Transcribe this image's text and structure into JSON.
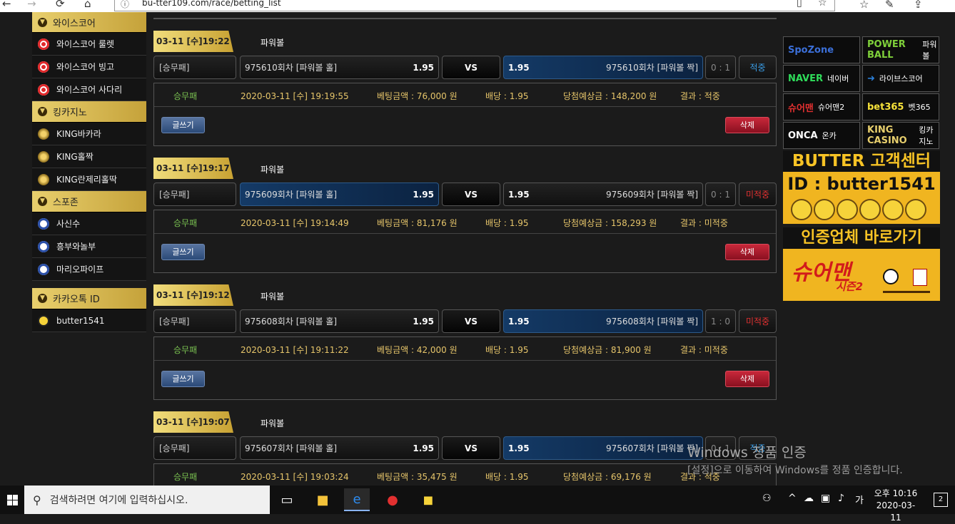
{
  "browser": {
    "url": "bu-tter109.com/race/betting_list",
    "back": "←",
    "forward": "→",
    "refresh": "⟳",
    "home": "⌂",
    "reading": "▯",
    "fav": "☆",
    "favs": "☆",
    "pen": "✎",
    "share": "⇪"
  },
  "sidebar": {
    "sections": [
      {
        "title": "와이스코어",
        "items": [
          "와이스코어 룰렛",
          "와이스코어 빙고",
          "와이스코어 사다리"
        ]
      },
      {
        "title": "킹카지노",
        "items": [
          "KING바카라",
          "KING홀짝",
          "KING란제리홀딱"
        ]
      },
      {
        "title": "스포존",
        "items": [
          "사신수",
          "흥부와놀부",
          "마리오파이프"
        ]
      },
      {
        "title": "카카오톡 ID",
        "items": [
          "butter1541"
        ]
      }
    ]
  },
  "labels": {
    "vs": "VS",
    "write": "글쓰기",
    "delete": "삭제"
  },
  "bets": [
    {
      "date": "03-11 [수]19:22",
      "game": "파워볼",
      "type": "[승무패]",
      "home": "975610회차 [파워볼 홀]",
      "home_odds": "1.95",
      "away": "975610회차 [파워볼 짝]",
      "away_odds": "1.95",
      "selected": "away",
      "score": "0 : 1",
      "result": "적중",
      "result_color": "#3a9ee8",
      "d_type": "승무패",
      "d_time": "2020-03-11 [수] 19:19:55",
      "d_amount": "베팅금액 : 76,000 원",
      "d_odds": "배당 : 1.95",
      "d_expect": "당첨예상금 : 148,200 원",
      "d_result": "결과 : 적중"
    },
    {
      "date": "03-11 [수]19:17",
      "game": "파워볼",
      "type": "[승무패]",
      "home": "975609회차 [파워볼 홀]",
      "home_odds": "1.95",
      "away": "975609회차 [파워볼 짝]",
      "away_odds": "1.95",
      "selected": "home",
      "score": "0 : 1",
      "result": "미적중",
      "result_color": "#e23030",
      "d_type": "승무패",
      "d_time": "2020-03-11 [수] 19:14:49",
      "d_amount": "베팅금액 : 81,176 원",
      "d_odds": "배당 : 1.95",
      "d_expect": "당첨예상금 : 158,293 원",
      "d_result": "결과 : 미적중"
    },
    {
      "date": "03-11 [수]19:12",
      "game": "파워볼",
      "type": "[승무패]",
      "home": "975608회차 [파워볼 홀]",
      "home_odds": "1.95",
      "away": "975608회차 [파워볼 짝]",
      "away_odds": "1.95",
      "selected": "away",
      "score": "1 : 0",
      "result": "미적중",
      "result_color": "#e23030",
      "d_type": "승무패",
      "d_time": "2020-03-11 [수] 19:11:22",
      "d_amount": "베팅금액 : 42,000 원",
      "d_odds": "배당 : 1.95",
      "d_expect": "당첨예상금 : 81,900 원",
      "d_result": "결과 : 미적중"
    },
    {
      "date": "03-11 [수]19:07",
      "game": "파워볼",
      "type": "[승무패]",
      "home": "975607회차 [파워볼 홀]",
      "home_odds": "1.95",
      "away": "975607회차 [파워볼 짝]",
      "away_odds": "1.95",
      "selected": "away",
      "score": "0 : 1",
      "result": "적중",
      "result_color": "#3a9ee8",
      "d_type": "승무패",
      "d_time": "2020-03-11 [수] 19:03:24",
      "d_amount": "베팅금액 : 35,475 원",
      "d_odds": "배당 : 1.95",
      "d_expect": "당첨예상금 : 69,176 원",
      "d_result": "결과 : 적중"
    }
  ],
  "partners": [
    {
      "logo": "SpoZone",
      "label": "",
      "logo_color": "#3b6fd8"
    },
    {
      "logo": "POWER BALL",
      "label": "파워볼",
      "logo_color": "#7fd03a"
    },
    {
      "logo": "NAVER",
      "label": "네이버",
      "logo_color": "#2fdc5a"
    },
    {
      "logo": "➜",
      "label": "라이브스코어",
      "logo_color": "#2b7fd8"
    },
    {
      "logo": "슈어맨",
      "label": "슈어맨2",
      "logo_color": "#e23030"
    },
    {
      "logo": "bet365",
      "label": "벳365",
      "logo_color": "#f7e23a"
    },
    {
      "logo": "ONCA",
      "label": "온카",
      "logo_color": "#ffffff"
    },
    {
      "logo": "KING CASINO",
      "label": "킹카지노",
      "logo_color": "#e8cf6d"
    }
  ],
  "butter": {
    "title": "BUTTER 고객센터",
    "id": "ID : butter1541"
  },
  "cert": {
    "title": "인증업체 바로가기",
    "brand": "슈어맨",
    "season": "시즌2"
  },
  "watermark": {
    "title": "Windows 정품 인증",
    "text": "[설정]으로 이동하여 Windows를 정품 인증합니다."
  },
  "taskbar": {
    "search_placeholder": "검색하려면 여기에 입력하십시오.",
    "time": "오후 10:16",
    "date": "2020-03-11",
    "notifications": "2"
  }
}
